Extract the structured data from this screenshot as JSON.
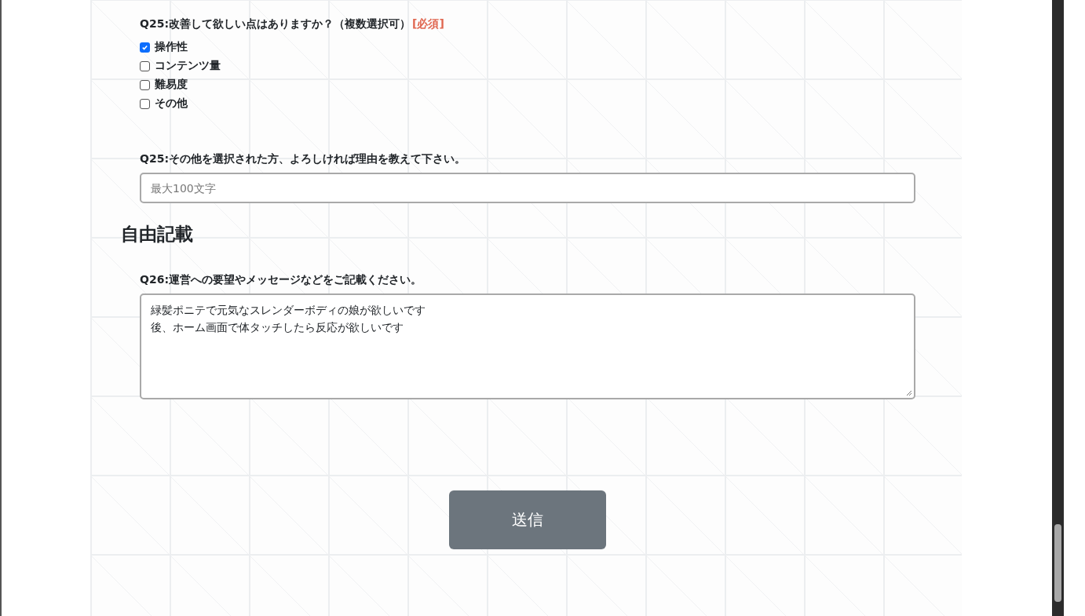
{
  "questions": [
    {
      "kind": "checkboxes",
      "label": "Q25:改善して欲しい点はありますか？（複数選択可）",
      "required": "[必須]",
      "options": [
        {
          "label": "操作性",
          "checked": true
        },
        {
          "label": "コンテンツ量",
          "checked": false
        },
        {
          "label": "難易度",
          "checked": false
        },
        {
          "label": "その他",
          "checked": false
        }
      ]
    },
    {
      "kind": "text",
      "label": "Q25:その他を選択された方、よろしければ理由を教えて下さい。",
      "placeholder": "最大100文字"
    },
    {
      "kind": "heading",
      "label": "自由記載"
    },
    {
      "kind": "textarea",
      "label": "Q26:運営への要望やメッセージなどをご記載ください。",
      "lines": [
        "緑髪ポニテで元気なスレンダーボディの娘が欲しいです",
        "後、ホーム画面で体タッチしたら反応が欲しいです"
      ]
    }
  ],
  "submit": "送信"
}
